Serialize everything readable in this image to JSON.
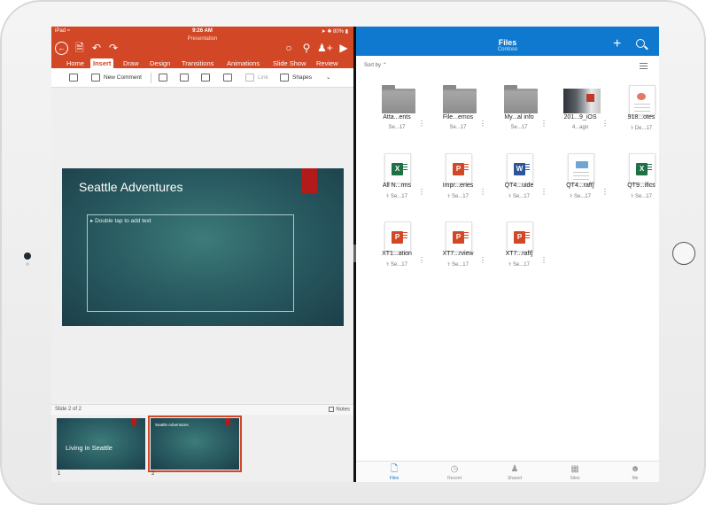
{
  "ppt": {
    "status": {
      "carrier": "iPad ",
      "time": "9:26 AM",
      "battery": "80%"
    },
    "doc_title": "Presentation",
    "tabs": [
      "Home",
      "Insert",
      "Draw",
      "Design",
      "Transitions",
      "Animations",
      "Slide Show",
      "Review"
    ],
    "active_tab": "Insert",
    "toolbar": {
      "new_comment": "New Comment",
      "link": "Link",
      "shapes": "Shapes"
    },
    "slide": {
      "title": "Seattle Adventures",
      "placeholder": "Double tap to add text"
    },
    "slide_count": "Slide 2 of 2",
    "notes": "Notes",
    "thumbnails": [
      {
        "number": "1",
        "title": "Living in Seattle"
      },
      {
        "number": "2",
        "title": "Seattle Adventures"
      }
    ],
    "colors": {
      "accent": "#d24726",
      "slide_bg": "#2a5d63"
    }
  },
  "onedrive": {
    "title": "Files",
    "subtitle": "Contoso",
    "sort_label": "Sort by",
    "files": [
      {
        "name": "Atta...ents",
        "meta": "Se...17",
        "kind": "folder",
        "shared": false
      },
      {
        "name": "File...emos",
        "meta": "Se...17",
        "kind": "folder",
        "shared": false
      },
      {
        "name": "My...al info",
        "meta": "Se...17",
        "kind": "folder",
        "shared": false
      },
      {
        "name": "201...9_iOS",
        "meta": "4...ago",
        "kind": "photo",
        "shared": false
      },
      {
        "name": "918...otes",
        "meta": "De...17",
        "kind": "paper",
        "shared": true
      },
      {
        "name": "All N...rms",
        "meta": "Se...17",
        "kind": "excel",
        "shared": true
      },
      {
        "name": "Impr...eries",
        "meta": "Se...17",
        "kind": "ppt",
        "shared": true
      },
      {
        "name": "QT4...uide",
        "meta": "Se...17",
        "kind": "word",
        "shared": true
      },
      {
        "name": "QT4...raft]",
        "meta": "Se...17",
        "kind": "map",
        "shared": true
      },
      {
        "name": "QT9...ifics",
        "meta": "Se...17",
        "kind": "excel",
        "shared": true
      },
      {
        "name": "XT1...ation",
        "meta": "Se...17",
        "kind": "ppt",
        "shared": true
      },
      {
        "name": "XT7...rview",
        "meta": "Se...17",
        "kind": "ppt",
        "shared": true
      },
      {
        "name": "XT7...raft]",
        "meta": "Se...17",
        "kind": "ppt",
        "shared": true
      }
    ],
    "bottom_nav": [
      "Files",
      "Recent",
      "Shared",
      "Sites",
      "Me"
    ],
    "active_nav": "Files",
    "colors": {
      "accent": "#0f79d0",
      "excel": "#1e7145",
      "ppt": "#d24726",
      "word": "#2b579a"
    }
  }
}
